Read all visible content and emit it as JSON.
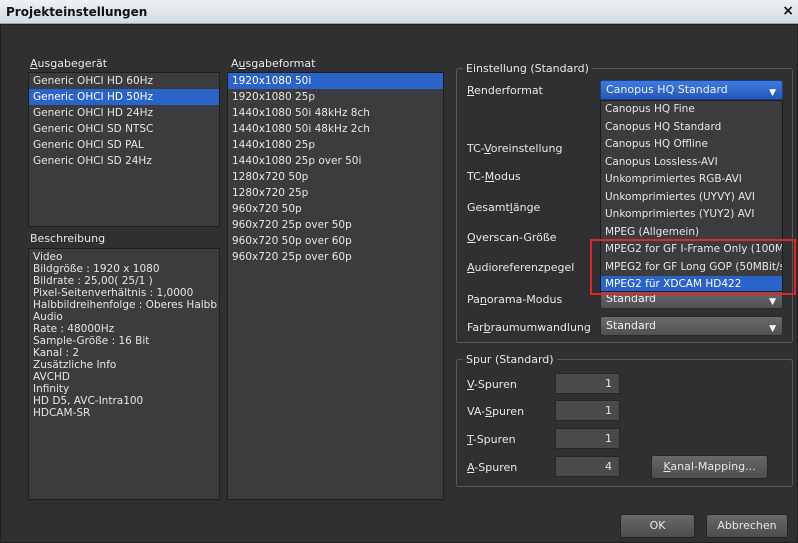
{
  "window": {
    "title": "Projekteinstellungen",
    "close_glyph": "×"
  },
  "output_device": {
    "label_prefix": "A",
    "label_rest": "usgabegerät",
    "items": [
      "Generic OHCI HD 60Hz",
      "Generic OHCI HD 50Hz",
      "Generic OHCI HD 24Hz",
      "Generic OHCI SD NTSC",
      "Generic OHCI SD PAL",
      "Generic OHCI SD 24Hz"
    ],
    "selected_index": 1
  },
  "output_format": {
    "label_a": "A",
    "label_u": "u",
    "label_rest": "sgabeformat",
    "items": [
      "1920x1080 50i",
      "1920x1080 25p",
      "1440x1080 50i 48kHz 8ch",
      "1440x1080 50i 48kHz 2ch",
      "1440x1080 25p",
      "1440x1080 25p over 50i",
      "1280x720 50p",
      "1280x720 25p",
      "960x720 50p",
      "960x720 25p over 50p",
      "960x720 50p over 60p",
      "960x720 25p over 60p"
    ],
    "selected_index": 0
  },
  "description": {
    "label": "Beschreibung",
    "lines": [
      "Video",
      "Bildgröße : 1920 x 1080",
      "Bildrate : 25,00( 25/1 )",
      "Pixel-Seitenverhältnis : 1,0000",
      "Halbbildreihenfolge : Oberes Halbb",
      "Audio",
      "Rate : 48000Hz",
      "Sample-Größe : 16 Bit",
      "Kanal : 2",
      "Zusätzliche Info",
      "AVCHD",
      "Infinity",
      "HD D5, AVC-Intra100",
      "HDCAM-SR"
    ]
  },
  "settings": {
    "group_label": "Einstellung (Standard)",
    "renderformat": {
      "label_u": "R",
      "label_rest": "enderformat",
      "value": "Canopus HQ Standard"
    },
    "tc_preset": {
      "label_pre": "TC-",
      "label_u": "V",
      "label_rest": "oreinstellung"
    },
    "tc_mode": {
      "label_pre": "TC-",
      "label_u": "M",
      "label_rest": "odus"
    },
    "total_length": {
      "label_pre": "Gesamt",
      "label_u": "l",
      "label_rest": "änge"
    },
    "overscan": {
      "label_u": "O",
      "label_rest": "verscan-Größe"
    },
    "audio_ref": {
      "label_u": "A",
      "label_rest": "udioreferenzpegel"
    },
    "panorama": {
      "label_pre": "Pa",
      "label_u": "n",
      "label_rest": "orama-Modus",
      "value": "Standard"
    },
    "colorspace": {
      "label_pre": "Far",
      "label_u": "b",
      "label_rest": "raumumwandlung",
      "value": "Standard"
    },
    "dropdown_options": [
      "Canopus HQ Fine",
      "Canopus HQ Standard",
      "Canopus HQ Offline",
      "Canopus Lossless-AVI",
      "Unkomprimiertes RGB-AVI",
      "Unkomprimiertes (UYVY) AVI",
      "Unkomprimiertes (YUY2) AVI",
      "MPEG (Allgemein)",
      "MPEG2 for GF I-Frame Only (100M",
      "MPEG2 for GF Long GOP (50MBit/s",
      "MPEG2 für XDCAM HD422"
    ],
    "dropdown_selected_index": 10
  },
  "tracks": {
    "group_label": "Spur (Standard)",
    "v": {
      "label_u": "V",
      "label_rest": "-Spuren",
      "value": "1"
    },
    "va": {
      "label_pre": "VA-",
      "label_u": "S",
      "label_rest": "puren",
      "value": "1"
    },
    "t": {
      "label_u": "T",
      "label_rest": "-Spuren",
      "value": "1"
    },
    "a": {
      "label_u": "A",
      "label_rest": "-Spuren",
      "value": "4"
    },
    "mapping_button": {
      "label_u": "K",
      "label_rest": "anal-Mapping..."
    }
  },
  "buttons": {
    "ok": "OK",
    "cancel": "Abbrechen"
  },
  "colors": {
    "selection": "#2a63c9",
    "highlight_box": "#e0262a",
    "background": "#2f2f31"
  }
}
